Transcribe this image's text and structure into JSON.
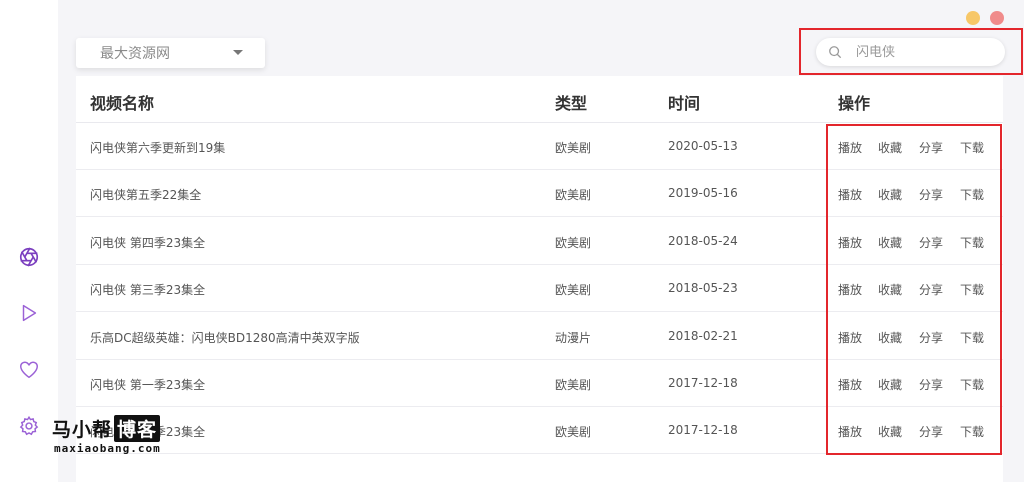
{
  "window": {
    "dot_colors": [
      "#f7c768",
      "#f08b8b"
    ]
  },
  "sidebar": {
    "items": [
      {
        "icon": "aperture-icon",
        "active": true,
        "color": "#7b3fbf"
      },
      {
        "icon": "play-icon",
        "active": false,
        "color": "#9b62d6"
      },
      {
        "icon": "heart-icon",
        "active": false,
        "color": "#9b62d6"
      },
      {
        "icon": "gear-icon",
        "active": false,
        "color": "#9b62d6"
      }
    ]
  },
  "source_select": {
    "selected": "最大资源网"
  },
  "search": {
    "placeholder": "闪电侠",
    "value": ""
  },
  "table": {
    "columns": [
      "视频名称",
      "类型",
      "时间",
      "操作"
    ],
    "action_labels": [
      "播放",
      "收藏",
      "分享",
      "下载"
    ],
    "rows": [
      {
        "name": "闪电侠第六季更新到19集",
        "type": "欧美剧",
        "date": "2020-05-13"
      },
      {
        "name": "闪电侠第五季22集全",
        "type": "欧美剧",
        "date": "2019-05-16"
      },
      {
        "name": "闪电侠 第四季23集全",
        "type": "欧美剧",
        "date": "2018-05-24"
      },
      {
        "name": "闪电侠 第三季23集全",
        "type": "欧美剧",
        "date": "2018-05-23"
      },
      {
        "name": "乐高DC超级英雄：闪电侠BD1280高清中英双字版",
        "type": "动漫片",
        "date": "2018-02-21"
      },
      {
        "name": "闪电侠 第一季23集全",
        "type": "欧美剧",
        "date": "2017-12-18"
      },
      {
        "name": "闪电侠 第二季23集全",
        "type": "欧美剧",
        "date": "2017-12-18"
      }
    ]
  },
  "watermark": {
    "text_plain": "马小帮",
    "text_boxed": "博客",
    "url": "maxiaobang.com"
  },
  "colors": {
    "highlight": "#e3262c",
    "accent": "#7b3fbf"
  }
}
